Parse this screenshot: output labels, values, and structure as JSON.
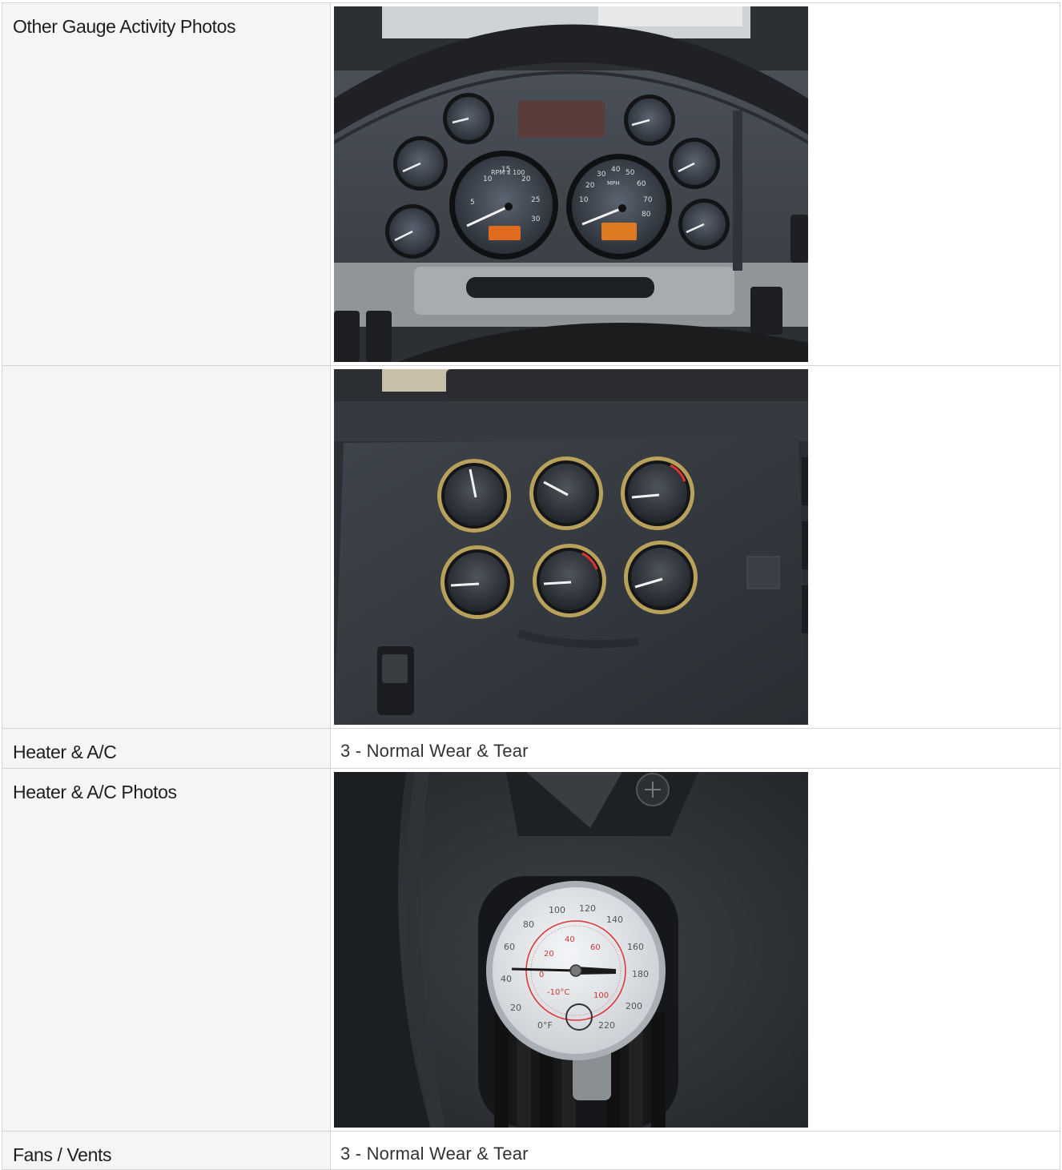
{
  "rows": [
    {
      "label": "Other Gauge Activity Photos",
      "type": "photo",
      "photo": "instrument-cluster-photo"
    },
    {
      "label": "",
      "type": "photo",
      "photo": "auxiliary-gauges-photo"
    },
    {
      "label": "Heater & A/C",
      "type": "text",
      "value": "3 - Normal Wear & Tear"
    },
    {
      "label": "Heater & A/C Photos",
      "type": "photo",
      "photo": "vent-thermometer-photo"
    },
    {
      "label": "Fans / Vents",
      "type": "text",
      "value": "3 - Normal Wear & Tear"
    }
  ],
  "photo1": {
    "tach_ticks": [
      "5",
      "10",
      "15",
      "20",
      "25",
      "30"
    ],
    "tach_unit": "RPM x 100",
    "speed_ticks": [
      "10",
      "20",
      "30",
      "40",
      "50",
      "60",
      "70",
      "80"
    ],
    "speed_unit": "MPH"
  },
  "photo3": {
    "outer_ticks": [
      "20",
      "40",
      "60",
      "80",
      "100",
      "120",
      "140",
      "160",
      "180",
      "200",
      "220"
    ],
    "inner_ticks": [
      "-10°C",
      "0",
      "20",
      "40",
      "60",
      "100"
    ],
    "unit_f": "0°F"
  }
}
